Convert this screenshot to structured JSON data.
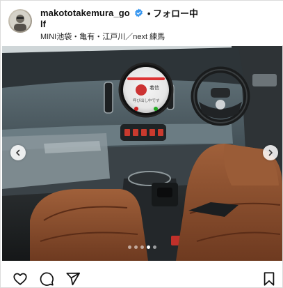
{
  "header": {
    "username": "makototakemura_go",
    "username_wrap": "lf",
    "follow_label": "フォロー中",
    "location": "MINI池袋・亀有・江戸川／next 練馬"
  },
  "screen": {
    "line1": "着信",
    "line2": "呼び出し中です"
  },
  "carousel": {
    "total_slides": 5,
    "active_slide": 4
  },
  "icons": {
    "avatar": "avatar",
    "verified": "verified-badge-icon",
    "more": "more-options-icon",
    "prev": "chevron-left-icon",
    "next": "chevron-right-icon",
    "like": "heart-icon",
    "comment": "comment-icon",
    "share": "paper-plane-icon",
    "save": "bookmark-icon"
  },
  "colors": {
    "verified": "#3897f0",
    "seat": "#8b4e2e",
    "dashboard": "#4a5a62"
  }
}
